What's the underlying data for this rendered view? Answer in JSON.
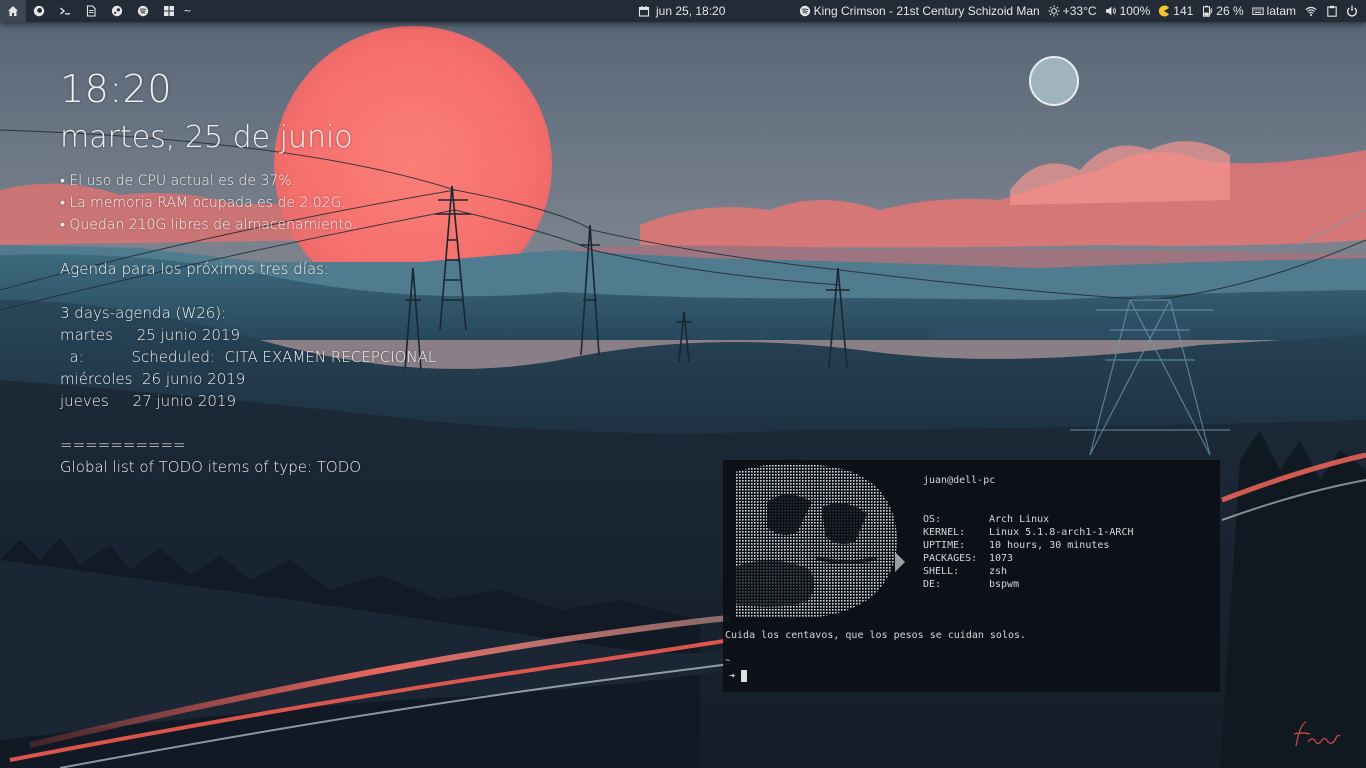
{
  "topbar": {
    "workspaces": [
      {
        "icon": "home-icon",
        "active": true
      },
      {
        "icon": "firefox-icon",
        "active": false
      },
      {
        "icon": "terminal-icon",
        "active": false
      },
      {
        "icon": "document-icon",
        "active": false
      },
      {
        "icon": "steam-icon",
        "active": false
      },
      {
        "icon": "spotify-icon",
        "active": false
      },
      {
        "icon": "grid-icon",
        "active": false
      }
    ],
    "cwd": "~",
    "datetime": "jun 25, 18:20",
    "music": "King Crimson - 21st Century Schizoid Man",
    "weather": "+33°C",
    "volume": "100%",
    "updates": "141",
    "battery": "26 %",
    "keyboard_layout": "latam",
    "colors": {
      "bar_bg": "#232b36",
      "active_ws": "#3d4654"
    }
  },
  "conky": {
    "clock": "18:20",
    "date": "martes, 25 de junio",
    "stats": [
      "• El uso de CPU actual es de 37%.",
      "• La memoria RAM ocupada es de 2.02G.",
      "• Quedan 210G libres de almacenamiento."
    ],
    "agenda_header": "Agenda para los próximos tres días:",
    "agenda_title": "3 days-agenda (W26):",
    "agenda_rows": [
      "martes     25 junio 2019",
      "  a:          Scheduled:  CITA EXAMEN RECEPCIONAL",
      "miércoles  26 junio 2019",
      "jueves     27 junio 2019"
    ],
    "separator": "==========",
    "todo_header": "Global list of TODO items of type: TODO"
  },
  "terminal": {
    "user_host": "juan@dell-pc",
    "info": [
      {
        "key": "OS:",
        "value": "Arch Linux"
      },
      {
        "key": "KERNEL:",
        "value": "Linux 5.1.8-arch1-1-ARCH"
      },
      {
        "key": "UPTIME:",
        "value": "10 hours, 30 minutes"
      },
      {
        "key": "PACKAGES:",
        "value": "1073"
      },
      {
        "key": "SHELL:",
        "value": "zsh"
      },
      {
        "key": "DE:",
        "value": "bspwm"
      }
    ],
    "quote": "Cuida los centavos, que los pesos se cuidan solos.",
    "cwd": "~",
    "prompt_symbol": "➜"
  }
}
